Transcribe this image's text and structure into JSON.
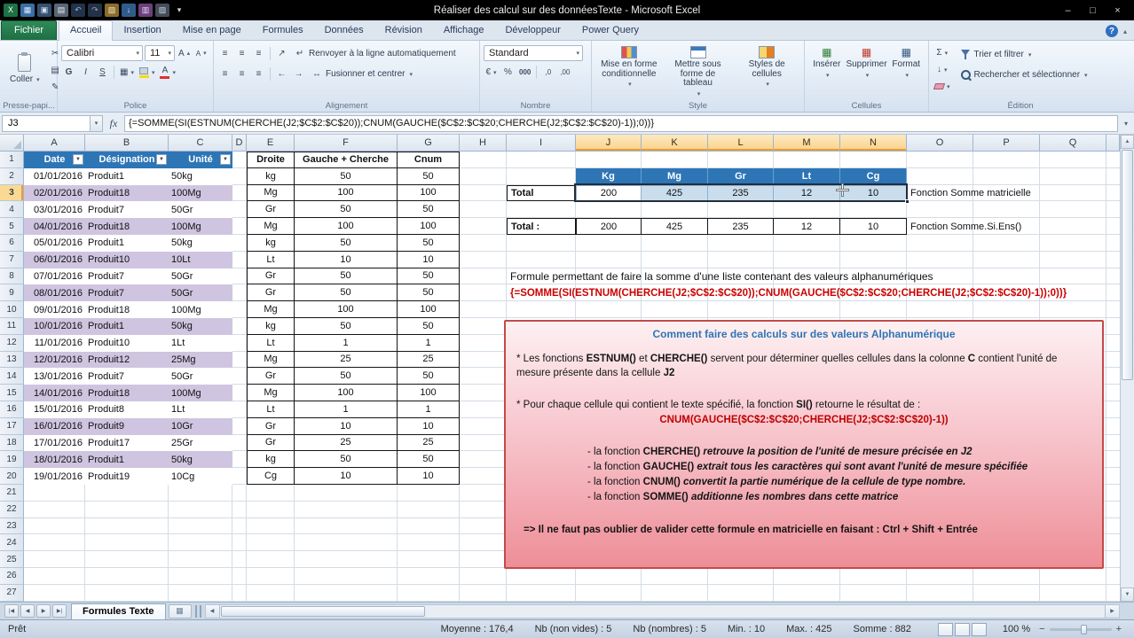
{
  "window": {
    "title": "Réaliser des calcul sur des donnéesTexte - Microsoft Excel",
    "qat_icons": [
      {
        "name": "excel-logo-icon",
        "glyph": "X",
        "bg": "#1e7145",
        "fg": "#ffffff"
      },
      {
        "name": "new-workbook-icon",
        "glyph": "▦",
        "bg": "#3a6ea5",
        "fg": "#dce9f8"
      },
      {
        "name": "save-icon",
        "glyph": "▣",
        "bg": "#35506e",
        "fg": "#cfe0f5"
      },
      {
        "name": "print-icon",
        "glyph": "▤",
        "bg": "#5a6675",
        "fg": "#e8edf3"
      },
      {
        "name": "undo-icon",
        "glyph": "↶",
        "bg": "#233246",
        "fg": "#7fb2ff"
      },
      {
        "name": "redo-icon",
        "glyph": "↷",
        "bg": "#233246",
        "fg": "#93a1b3"
      },
      {
        "name": "open-icon",
        "glyph": "▧",
        "bg": "#8a6d2f",
        "fg": "#f5e6bf"
      },
      {
        "name": "sort-icon",
        "glyph": "↓",
        "bg": "#2f5d8a",
        "fg": "#cfe0f5"
      },
      {
        "name": "chart-icon",
        "glyph": "▥",
        "bg": "#6a3f7a",
        "fg": "#ecd9f5"
      },
      {
        "name": "paste-icon",
        "glyph": "▨",
        "bg": "#444c58",
        "fg": "#ccd4de"
      },
      {
        "name": "qat-menu-icon",
        "glyph": "▾",
        "bg": "transparent",
        "fg": "#cfd6df"
      }
    ],
    "controls": {
      "minimize": "–",
      "maximize": "□",
      "close": "×"
    }
  },
  "icons": {
    "minimize": "–",
    "maximize": "□",
    "close": "×",
    "help": "?",
    "ribbon_collapse": "▴",
    "dropdown": "▾",
    "filter": "▼",
    "cut": "✂",
    "copy": "▤",
    "format_painter": "✎",
    "borders": "▦",
    "up": "▴",
    "down": "▾",
    "wrap": "↵",
    "orientation": "↗",
    "merge": "↔",
    "indent_left": "←",
    "indent_right": "→",
    "align": "≡",
    "currency": "€",
    "percent": "%",
    "thousands": "000",
    "dec_add": ",0",
    "dec_del": ",00",
    "sum": "Σ",
    "fill": "↓",
    "insert_cells": "▦",
    "delete_cells": "▦",
    "format_cells": "▦",
    "nav_first": "|◀",
    "nav_prev": "◀",
    "nav_next": "▶",
    "nav_last": "▶|",
    "scroll_left": "◀",
    "scroll_right": "▶",
    "scroll_up": "▲",
    "scroll_down": "▼",
    "new_sheet": "▦",
    "grow_font": "A",
    "shrink_font": "A",
    "font_color_letter": "A"
  },
  "ribbon": {
    "tabs": [
      {
        "label": "Fichier",
        "type": "file"
      },
      {
        "label": "Accueil",
        "active": true
      },
      {
        "label": "Insertion"
      },
      {
        "label": "Mise en page"
      },
      {
        "label": "Formules"
      },
      {
        "label": "Données"
      },
      {
        "label": "Révision"
      },
      {
        "label": "Affichage"
      },
      {
        "label": "Développeur"
      },
      {
        "label": "Power Query"
      }
    ],
    "groups": {
      "clipboard": {
        "label": "Presse-papi...",
        "paste": "Coller"
      },
      "font": {
        "label": "Police",
        "name": "Calibri",
        "size": "11",
        "bold": "G",
        "italic": "I",
        "underline": "S"
      },
      "alignment": {
        "label": "Alignement",
        "wrap": "Renvoyer à la ligne automatiquement",
        "merge": "Fusionner et centrer"
      },
      "number": {
        "label": "Nombre",
        "format": "Standard"
      },
      "style": {
        "label": "Style",
        "conditional": "Mise en forme conditionnelle",
        "table": "Mettre sous forme de tableau",
        "cell_styles": "Styles de cellules"
      },
      "cells": {
        "label": "Cellules",
        "insert": "Insérer",
        "delete": "Supprimer",
        "format": "Format"
      },
      "editing": {
        "label": "Édition",
        "sort": "Trier et filtrer",
        "find": "Rechercher et sélectionner"
      }
    }
  },
  "formula_bar": {
    "name_box": "J3",
    "fx_label": "fx",
    "formula": "{=SOMME(SI(ESTNUM(CHERCHE(J2;$C$2:$C$20));CNUM(GAUCHE($C$2:$C$20;CHERCHE(J2;$C$2:$C$20)-1));0))}"
  },
  "grid": {
    "columns": [
      {
        "id": "A",
        "w": 69
      },
      {
        "id": "B",
        "w": 94
      },
      {
        "id": "C",
        "w": 72
      },
      {
        "id": "D",
        "w": 16
      },
      {
        "id": "E",
        "w": 54
      },
      {
        "id": "F",
        "w": 116
      },
      {
        "id": "G",
        "w": 70
      },
      {
        "id": "H",
        "w": 53
      },
      {
        "id": "I",
        "w": 78
      },
      {
        "id": "J",
        "w": 74
      },
      {
        "id": "K",
        "w": 75
      },
      {
        "id": "L",
        "w": 74
      },
      {
        "id": "M",
        "w": 75
      },
      {
        "id": "N",
        "w": 75
      },
      {
        "id": "O",
        "w": 75
      },
      {
        "id": "P",
        "w": 75
      },
      {
        "id": "Q",
        "w": 75
      }
    ],
    "row_count": 27,
    "selected_cols": [
      "J",
      "K",
      "L",
      "M",
      "N"
    ],
    "selected_rows": [
      3
    ],
    "data_table": {
      "headers": [
        "Date",
        "Désignation",
        "Unité"
      ],
      "rows": [
        [
          "01/01/2016",
          "Produit1",
          "50kg"
        ],
        [
          "02/01/2016",
          "Produit18",
          "100Mg"
        ],
        [
          "03/01/2016",
          "Produit7",
          "50Gr"
        ],
        [
          "04/01/2016",
          "Produit18",
          "100Mg"
        ],
        [
          "05/01/2016",
          "Produit1",
          "50kg"
        ],
        [
          "06/01/2016",
          "Produit10",
          "10Lt"
        ],
        [
          "07/01/2016",
          "Produit7",
          "50Gr"
        ],
        [
          "08/01/2016",
          "Produit7",
          "50Gr"
        ],
        [
          "09/01/2016",
          "Produit18",
          "100Mg"
        ],
        [
          "10/01/2016",
          "Produit1",
          "50kg"
        ],
        [
          "11/01/2016",
          "Produit10",
          "1Lt"
        ],
        [
          "12/01/2016",
          "Produit12",
          "25Mg"
        ],
        [
          "13/01/2016",
          "Produit7",
          "50Gr"
        ],
        [
          "14/01/2016",
          "Produit18",
          "100Mg"
        ],
        [
          "15/01/2016",
          "Produit8",
          "1Lt"
        ],
        [
          "16/01/2016",
          "Produit9",
          "10Gr"
        ],
        [
          "17/01/2016",
          "Produit17",
          "25Gr"
        ],
        [
          "18/01/2016",
          "Produit1",
          "50kg"
        ],
        [
          "19/01/2016",
          "Produit19",
          "10Cg"
        ]
      ]
    },
    "helper_table": {
      "headers": [
        "Droite",
        "Gauche + Cherche",
        "Cnum"
      ],
      "rows": [
        [
          "kg",
          "50",
          "50"
        ],
        [
          "Mg",
          "100",
          "100"
        ],
        [
          "Gr",
          "50",
          "50"
        ],
        [
          "Mg",
          "100",
          "100"
        ],
        [
          "kg",
          "50",
          "50"
        ],
        [
          "Lt",
          "10",
          "10"
        ],
        [
          "Gr",
          "50",
          "50"
        ],
        [
          "Gr",
          "50",
          "50"
        ],
        [
          "Mg",
          "100",
          "100"
        ],
        [
          "kg",
          "50",
          "50"
        ],
        [
          "Lt",
          "1",
          "1"
        ],
        [
          "Mg",
          "25",
          "25"
        ],
        [
          "Gr",
          "50",
          "50"
        ],
        [
          "Mg",
          "100",
          "100"
        ],
        [
          "Lt",
          "1",
          "1"
        ],
        [
          "Gr",
          "10",
          "10"
        ],
        [
          "Gr",
          "25",
          "25"
        ],
        [
          "kg",
          "50",
          "50"
        ],
        [
          "Cg",
          "10",
          "10"
        ]
      ]
    },
    "summary": {
      "unit_headers": [
        "Kg",
        "Mg",
        "Gr",
        "Lt",
        "Cg"
      ],
      "row1_label": "Total",
      "row1_values": [
        "200",
        "425",
        "235",
        "12",
        "10"
      ],
      "row1_note": "Fonction Somme matricielle",
      "row2_label": "Total :",
      "row2_values": [
        "200",
        "425",
        "235",
        "12",
        "10"
      ],
      "row2_note": "Fonction Somme.Si.Ens()"
    },
    "annotation": {
      "line1": "Formule permettant de faire la somme d'une liste contenant des valeurs alphanumériques",
      "line2": "{=SOMME(SI(ESTNUM(CHERCHE(J2;$C$2:$C$20));CNUM(GAUCHE($C$2:$C$20;CHERCHE(J2;$C$2:$C$20)-1));0))}"
    },
    "infobox": {
      "title": "Comment faire des calculs sur des  valeurs  Alphanumérique",
      "para1": [
        {
          "t": "*  Les fonctions "
        },
        {
          "t": "ESTNUM()",
          "b": true
        },
        {
          "t": " et "
        },
        {
          "t": "CHERCHE()",
          "b": true
        },
        {
          "t": " servent pour déterminer quelles cellules dans la colonne "
        },
        {
          "t": "C",
          "b": true
        },
        {
          "t": " contient l'unité de mesure présente dans la cellule "
        },
        {
          "t": "J2",
          "b": true
        }
      ],
      "para2": [
        {
          "t": "*  Pour chaque cellule qui contient le texte spécifié, la fonction "
        },
        {
          "t": "SI()",
          "b": true
        },
        {
          "t": " retourne le résultat de :"
        }
      ],
      "formula_line": [
        {
          "t": "CNUM(GAUCHE($C$2:$C$20;CHERCHE(J2;$C$2:$C$20)-1))",
          "b": true,
          "r": true
        }
      ],
      "bullets": [
        [
          {
            "t": "- la fonction "
          },
          {
            "t": "CHERCHE()",
            "b": true
          },
          {
            "t": " retrouve la position de l'unité de mesure précisée en J2",
            "b": true,
            "i": true
          }
        ],
        [
          {
            "t": "- la fonction "
          },
          {
            "t": "GAUCHE()",
            "b": true
          },
          {
            "t": " extrait tous les caractères qui sont avant l'unité de mesure spécifiée",
            "b": true,
            "i": true
          }
        ],
        [
          {
            "t": "- la fonction "
          },
          {
            "t": "CNUM()",
            "b": true
          },
          {
            "t": " convertit la partie numérique de la cellule de type nombre.",
            "b": true,
            "i": true
          }
        ],
        [
          {
            "t": "- la fonction "
          },
          {
            "t": "SOMME()",
            "b": true
          },
          {
            "t": " additionne  les nombres dans cette matrice",
            "b": true,
            "i": true
          }
        ]
      ],
      "final_line": [
        {
          "t": "=> Il ne faut pas oublier de valider cette formule en matricielle en faisant : ",
          "b": true
        },
        {
          "t": "Ctrl + Shift + Entrée",
          "b": true
        }
      ]
    }
  },
  "sheet_tabs": {
    "active": "Formules Texte"
  },
  "status": {
    "mode": "Prêt",
    "stats": [
      "Moyenne : 176,4",
      "Nb (non vides) : 5",
      "Nb (nombres) : 5",
      "Min. : 10",
      "Max. : 425",
      "Somme : 882"
    ],
    "zoom": "100 %"
  }
}
